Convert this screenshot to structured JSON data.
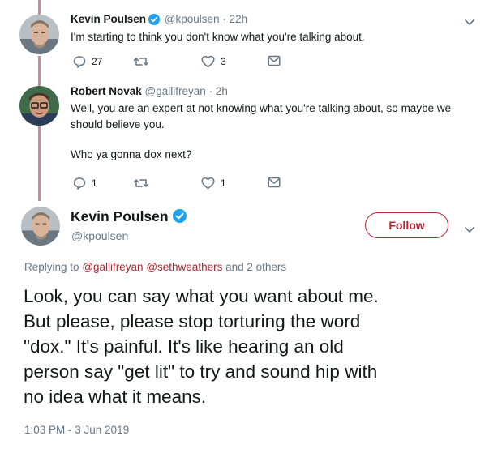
{
  "tweets": [
    {
      "name": "Kevin Poulsen",
      "handle": "@kpoulsen",
      "time": "· 22h",
      "text": "I'm starting to think you don't know what you're talking about.",
      "actions": {
        "replies": "27",
        "retweets": "",
        "likes": "3"
      },
      "verified": true
    },
    {
      "name": "Robert Novak",
      "handle": "@gallifreyan",
      "time": "· 2h",
      "text_lines": [
        "Well, you are an expert at not knowing what you're talking about, so maybe we",
        "should believe you.",
        "",
        "Who ya gonna dox next?"
      ],
      "actions": {
        "replies": "1",
        "retweets": "",
        "likes": "1"
      },
      "verified": false
    }
  ],
  "main_tweet": {
    "name": "Kevin Poulsen",
    "handle": "@kpoulsen",
    "follow_label": "Follow",
    "replying_prefix": "Replying to",
    "mention_1": "@gallifreyan",
    "mention_2": "@sethweathers",
    "replying_suffix": "and 2 others",
    "text_lines": [
      "Look, you can say what you want about me.",
      "But please, please stop torturing the word",
      "\"dox.\" It's painful. It's like hearing an old",
      "person say \"get lit\" to try and sound hip with",
      "no idea what it means."
    ],
    "timestamp": "1:03 PM - 3 Jun 2019"
  },
  "colors": {
    "accent": "#b2242f",
    "thread_line": "#cc8a93",
    "verified": "#1da1f2",
    "muted": "#657786"
  },
  "icons": [
    "reply-icon",
    "retweet-icon",
    "like-icon",
    "direct-message-icon",
    "verified-icon",
    "chevron-down-icon"
  ]
}
